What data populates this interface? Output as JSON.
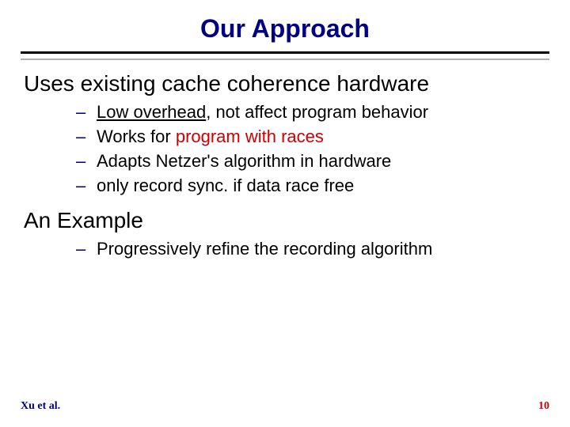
{
  "title": "Our Approach",
  "sections": [
    {
      "heading": "Uses existing cache coherence hardware",
      "items": [
        {
          "pre": "",
          "under": "Low overhead",
          "post": ", not affect program behavior"
        },
        {
          "pre": "Works for ",
          "red": "program with races",
          "post2": ""
        },
        {
          "plain": "Adapts Netzer's algorithm in hardware"
        },
        {
          "plain": "only record sync. if data race free"
        }
      ]
    },
    {
      "heading": "An Example",
      "items": [
        {
          "plain": "Progressively refine the recording algorithm"
        }
      ]
    }
  ],
  "footer": {
    "left": "Xu et al.",
    "right": "10"
  }
}
